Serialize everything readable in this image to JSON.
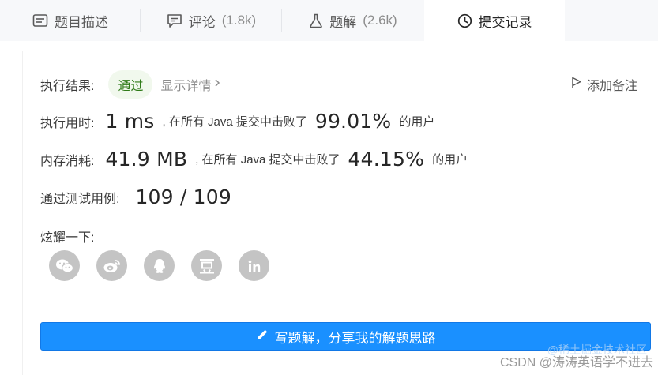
{
  "tabs": [
    {
      "icon": "description-icon",
      "label": "题目描述",
      "count": ""
    },
    {
      "icon": "comment-icon",
      "label": "评论",
      "count": "(1.8k)"
    },
    {
      "icon": "flask-icon",
      "label": "题解",
      "count": "(2.6k)"
    },
    {
      "icon": "clock-icon",
      "label": "提交记录",
      "count": ""
    }
  ],
  "result": {
    "label": "执行结果:",
    "status": "通过",
    "detail_link": "显示详情",
    "add_note": "添加备注"
  },
  "runtime": {
    "label": "执行用时:",
    "value": "1 ms",
    "mid_text": ", 在所有 Java 提交中击败了",
    "percent": "99.01%",
    "suffix": "的用户"
  },
  "memory": {
    "label": "内存消耗:",
    "value": "41.9 MB",
    "mid_text": ", 在所有 Java 提交中击败了",
    "percent": "44.15%",
    "suffix": "的用户"
  },
  "testcases": {
    "label": "通过测试用例:",
    "value": "109 / 109"
  },
  "share": {
    "label": "炫耀一下:",
    "icons": [
      "wechat-icon",
      "weibo-icon",
      "qq-icon",
      "douban-icon",
      "linkedin-icon"
    ]
  },
  "write_solution": {
    "label": "写题解，分享我的解题思路"
  },
  "watermark": {
    "text": "CSDN @涛涛英语学不进去",
    "faint": "@稀土掘金技术社区"
  },
  "colors": {
    "accent": "#1a90ff",
    "pass_bg": "#f1f8ed",
    "pass_text": "#2f7a18"
  }
}
